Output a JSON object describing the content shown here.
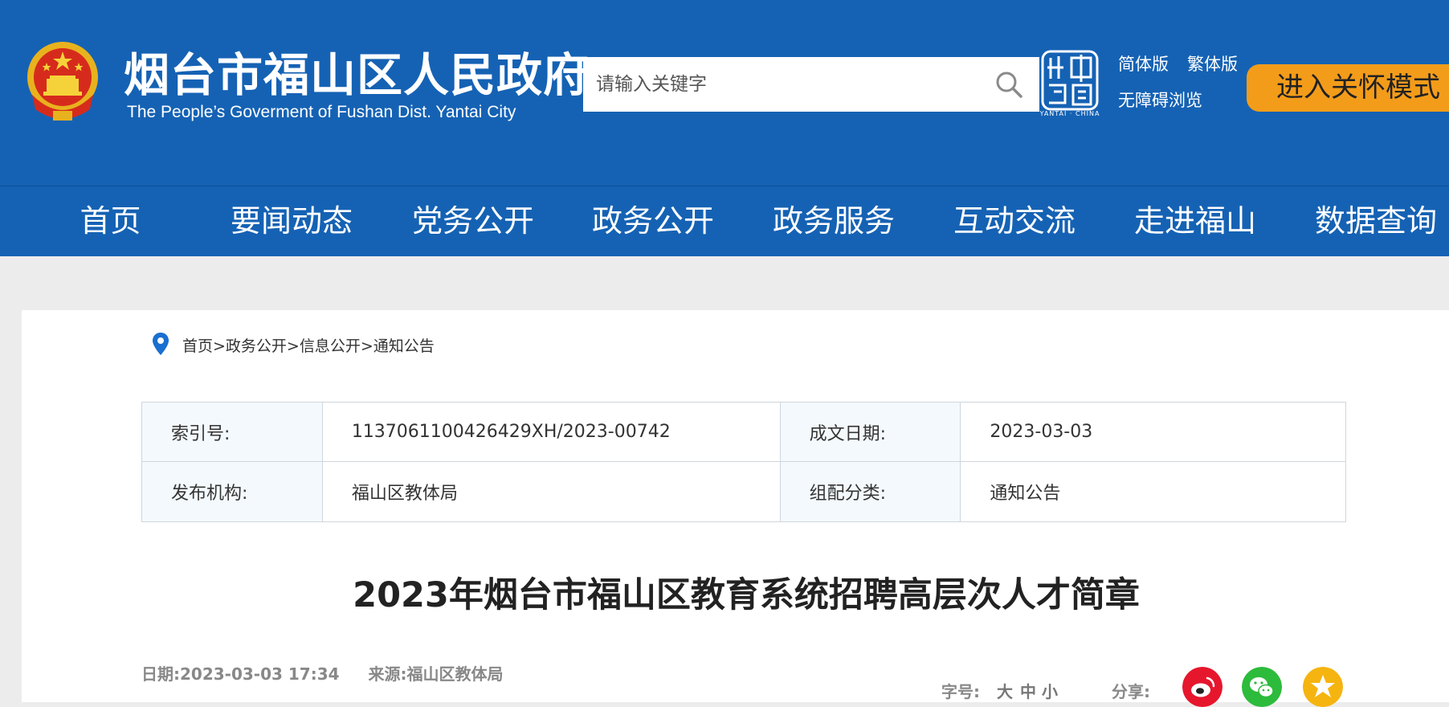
{
  "header": {
    "site_title": "烟台市福山区人民政府",
    "site_subtitle": "The People’s Goverment of Fushan Dist. Yantai City",
    "search_placeholder": "请输入关键字",
    "china_logo_sub": "YANTAI · CHINA",
    "links": {
      "simplified": "简体版",
      "traditional": "繁体版",
      "accessible": "无障碍浏览"
    },
    "care_mode": "进入关怀模式",
    "colors": {
      "brand_blue": "#1562b4",
      "care_orange": "#f39c1a"
    }
  },
  "nav": {
    "items": [
      "首页",
      "要闻动态",
      "党务公开",
      "政务公开",
      "政务服务",
      "互动交流",
      "走进福山",
      "数据查询"
    ]
  },
  "breadcrumb": {
    "text": "首页>政务公开>信息公开>通知公告"
  },
  "meta": {
    "index_label": "索引号:",
    "index_value": "1137061100426429XH/2023-00742",
    "date_label": "成文日期:",
    "date_value": "2023-03-03",
    "publisher_label": "发布机构:",
    "publisher_value": "福山区教体局",
    "category_label": "组配分类:",
    "category_value": "通知公告"
  },
  "article": {
    "title": "2023年烟台市福山区教育系统招聘高层次人才简章",
    "date_line": "日期:2023-03-03 17:34",
    "source_line": "来源:福山区教体局",
    "font_size_label": "字号:",
    "font_sizes": [
      "大",
      "中",
      "小"
    ],
    "share_label": "分享:",
    "share_icons": [
      "weibo-icon",
      "wechat-icon",
      "qzone-icon"
    ]
  }
}
